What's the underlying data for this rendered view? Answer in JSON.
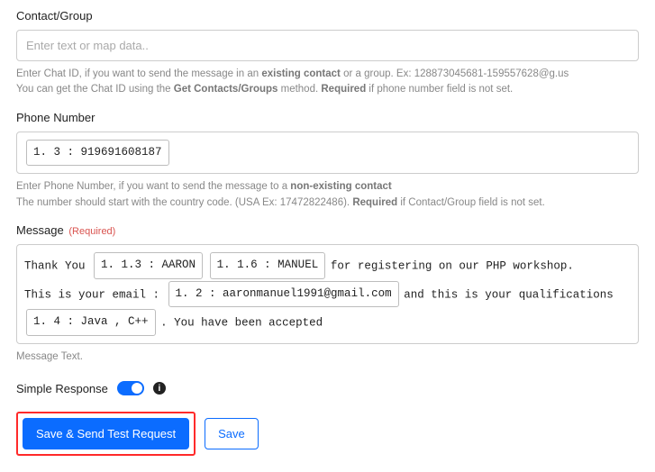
{
  "contact": {
    "label": "Contact/Group",
    "placeholder": "Enter text or map data..",
    "help_parts": {
      "a": "Enter Chat ID, if you want to send the message in an ",
      "b": "existing contact",
      "c": " or a group. Ex: 128873045681-159557628@g.us",
      "d": "You can get the Chat ID using the ",
      "e": "Get Contacts/Groups",
      "f": " method. ",
      "g": "Required",
      "h": " if phone number field is not set."
    }
  },
  "phone": {
    "label": "Phone Number",
    "token_value": "1. 3 : 919691608187",
    "help_parts": {
      "a": "Enter Phone Number, if you want to send the message to a ",
      "b": "non-existing contact",
      "c": "The number should start with the country code. (USA Ex: 17472822486). ",
      "d": "Required",
      "e": " if Contact/Group field is not set."
    }
  },
  "message": {
    "label": "Message",
    "required_tag": "(Required)",
    "text_parts": {
      "a": "Thank You ",
      "b": " for registering on our PHP workshop.",
      "c": "This is your email : ",
      "d": " and this is your qualifications",
      "e": " . You have been accepted"
    },
    "tokens": {
      "t1": "1. 1.3 : AARON",
      "t2": "1. 1.6 : MANUEL",
      "t3": "1. 2 : aaronmanuel1991@gmail.com",
      "t4": "1. 4 : Java , C++"
    },
    "help": "Message Text."
  },
  "simple_response": {
    "label": "Simple Response",
    "info_glyph": "i"
  },
  "buttons": {
    "primary": "Save & Send Test Request",
    "secondary": "Save"
  }
}
